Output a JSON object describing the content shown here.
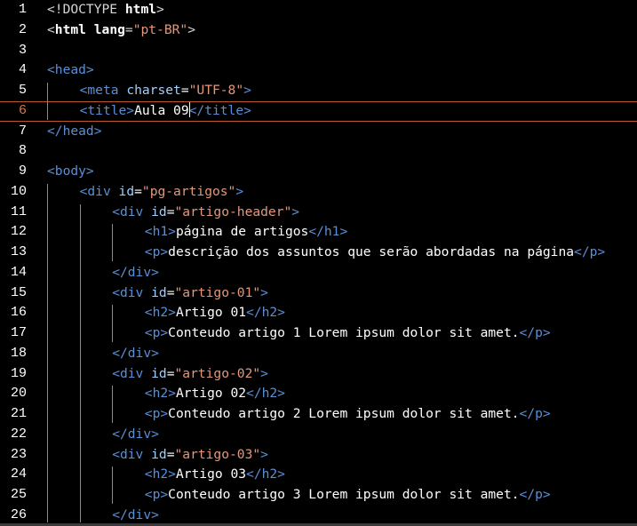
{
  "editor": {
    "active_line": 6,
    "lines": [
      {
        "n": "1",
        "indent": 0,
        "tokens": [
          [
            "doc",
            "<!DOCTYPE "
          ],
          [
            "bold",
            "html"
          ],
          [
            "doc",
            ">"
          ]
        ]
      },
      {
        "n": "2",
        "indent": 0,
        "tokens": [
          [
            "doc",
            "<"
          ],
          [
            "bold",
            "html"
          ],
          [
            "doc",
            " "
          ],
          [
            "bold",
            "lang"
          ],
          [
            "doc",
            "="
          ],
          [
            "str",
            "\"pt-BR\""
          ],
          [
            "doc",
            ">"
          ]
        ]
      },
      {
        "n": "3",
        "indent": 0,
        "tokens": []
      },
      {
        "n": "4",
        "indent": 0,
        "tokens": [
          [
            "tag",
            "<head>"
          ]
        ]
      },
      {
        "n": "5",
        "indent": 1,
        "tokens": [
          [
            "tag",
            "<meta "
          ],
          [
            "attr",
            "charset"
          ],
          [
            "txt",
            "="
          ],
          [
            "str",
            "\"UTF-8\""
          ],
          [
            "tag",
            ">"
          ]
        ]
      },
      {
        "n": "6",
        "indent": 1,
        "tokens": [
          [
            "tag",
            "<title>"
          ],
          [
            "txt",
            "Aula 09"
          ],
          [
            "caret",
            ""
          ],
          [
            "tag",
            "</title>"
          ]
        ]
      },
      {
        "n": "7",
        "indent": 0,
        "tokens": [
          [
            "tag",
            "</head>"
          ]
        ]
      },
      {
        "n": "8",
        "indent": 0,
        "tokens": []
      },
      {
        "n": "9",
        "indent": 0,
        "tokens": [
          [
            "tag",
            "<body>"
          ]
        ]
      },
      {
        "n": "10",
        "indent": 1,
        "tokens": [
          [
            "tag",
            "<div "
          ],
          [
            "attr",
            "id"
          ],
          [
            "txt",
            "="
          ],
          [
            "str",
            "\"pg-artigos\""
          ],
          [
            "tag",
            ">"
          ]
        ]
      },
      {
        "n": "11",
        "indent": 2,
        "tokens": [
          [
            "tag",
            "<div "
          ],
          [
            "attr",
            "id"
          ],
          [
            "txt",
            "="
          ],
          [
            "str",
            "\"artigo-header\""
          ],
          [
            "tag",
            ">"
          ]
        ]
      },
      {
        "n": "12",
        "indent": 3,
        "tokens": [
          [
            "tag",
            "<h1>"
          ],
          [
            "txt",
            "página de artigos"
          ],
          [
            "tag",
            "</h1>"
          ]
        ]
      },
      {
        "n": "13",
        "indent": 3,
        "tokens": [
          [
            "tag",
            "<p>"
          ],
          [
            "txt",
            "descrição dos assuntos que serão abordadas na página"
          ],
          [
            "tag",
            "</p>"
          ]
        ]
      },
      {
        "n": "14",
        "indent": 2,
        "tokens": [
          [
            "tag",
            "</div>"
          ]
        ]
      },
      {
        "n": "15",
        "indent": 2,
        "tokens": [
          [
            "tag",
            "<div "
          ],
          [
            "attr",
            "id"
          ],
          [
            "txt",
            "="
          ],
          [
            "str",
            "\"artigo-01\""
          ],
          [
            "tag",
            ">"
          ]
        ]
      },
      {
        "n": "16",
        "indent": 3,
        "tokens": [
          [
            "tag",
            "<h2>"
          ],
          [
            "txt",
            "Artigo 01"
          ],
          [
            "tag",
            "</h2>"
          ]
        ]
      },
      {
        "n": "17",
        "indent": 3,
        "tokens": [
          [
            "tag",
            "<p>"
          ],
          [
            "txt",
            "Conteudo artigo 1 Lorem ipsum dolor sit amet."
          ],
          [
            "tag",
            "</p>"
          ]
        ]
      },
      {
        "n": "18",
        "indent": 2,
        "tokens": [
          [
            "tag",
            "</div>"
          ]
        ]
      },
      {
        "n": "19",
        "indent": 2,
        "tokens": [
          [
            "tag",
            "<div "
          ],
          [
            "attr",
            "id"
          ],
          [
            "txt",
            "="
          ],
          [
            "str",
            "\"artigo-02\""
          ],
          [
            "tag",
            ">"
          ]
        ]
      },
      {
        "n": "20",
        "indent": 3,
        "tokens": [
          [
            "tag",
            "<h2>"
          ],
          [
            "txt",
            "Artigo 02"
          ],
          [
            "tag",
            "</h2>"
          ]
        ]
      },
      {
        "n": "21",
        "indent": 3,
        "tokens": [
          [
            "tag",
            "<p>"
          ],
          [
            "txt",
            "Conteudo artigo 2 Lorem ipsum dolor sit amet."
          ],
          [
            "tag",
            "</p>"
          ]
        ]
      },
      {
        "n": "22",
        "indent": 2,
        "tokens": [
          [
            "tag",
            "</div>"
          ]
        ]
      },
      {
        "n": "23",
        "indent": 2,
        "tokens": [
          [
            "tag",
            "<div "
          ],
          [
            "attr",
            "id"
          ],
          [
            "txt",
            "="
          ],
          [
            "str",
            "\"artigo-03\""
          ],
          [
            "tag",
            ">"
          ]
        ]
      },
      {
        "n": "24",
        "indent": 3,
        "tokens": [
          [
            "tag",
            "<h2>"
          ],
          [
            "txt",
            "Artigo 03"
          ],
          [
            "tag",
            "</h2>"
          ]
        ]
      },
      {
        "n": "25",
        "indent": 3,
        "tokens": [
          [
            "tag",
            "<p>"
          ],
          [
            "txt",
            "Conteudo artigo 3 Lorem ipsum dolor sit amet."
          ],
          [
            "tag",
            "</p>"
          ]
        ]
      },
      {
        "n": "26",
        "indent": 2,
        "tokens": [
          [
            "tag",
            "</div>"
          ]
        ]
      }
    ]
  },
  "colors": {
    "background": "#000000",
    "tag": "#5a8fd6",
    "attribute": "#9ed0ff",
    "string": "#e3987a",
    "text": "#ffffff",
    "active_line_border": "#b8562e",
    "active_line_number": "#d87a4a"
  }
}
